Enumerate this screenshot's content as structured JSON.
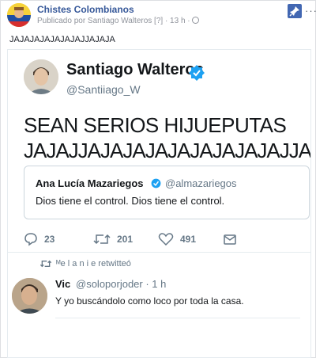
{
  "post": {
    "page_name": "Chistes Colombianos",
    "meta": "Publicado por Santiago Walteros [?] · 13 h ·",
    "text": "JAJAJAJAJAJAJAJJAJAJA",
    "more": "···"
  },
  "tweet": {
    "author_name": "Santiago Walteros",
    "author_handle": "@Santiiago_W",
    "line1": "SEAN SERIOS HIJUEPUTAS",
    "line2": "JAJAJJAJAJAJAJAJAJAJAJAJJA.",
    "quote": {
      "name": "Ana Lucía Mazariegos",
      "handle": "@almazariegos",
      "text": "Dios tiene el control. Dios tiene el control."
    },
    "replies": "23",
    "retweets": "201",
    "likes": "491"
  },
  "retweet": {
    "label": "ᴹe l a n i e retwitteó",
    "name": "Vic",
    "handle": "@soloporjoder · 1 h",
    "text": "Y yo buscándolo como loco por toda la casa."
  },
  "colors": {
    "fb_link": "#365899",
    "twitter_verified": "#1da1f2",
    "twitter_grey": "#657786"
  }
}
